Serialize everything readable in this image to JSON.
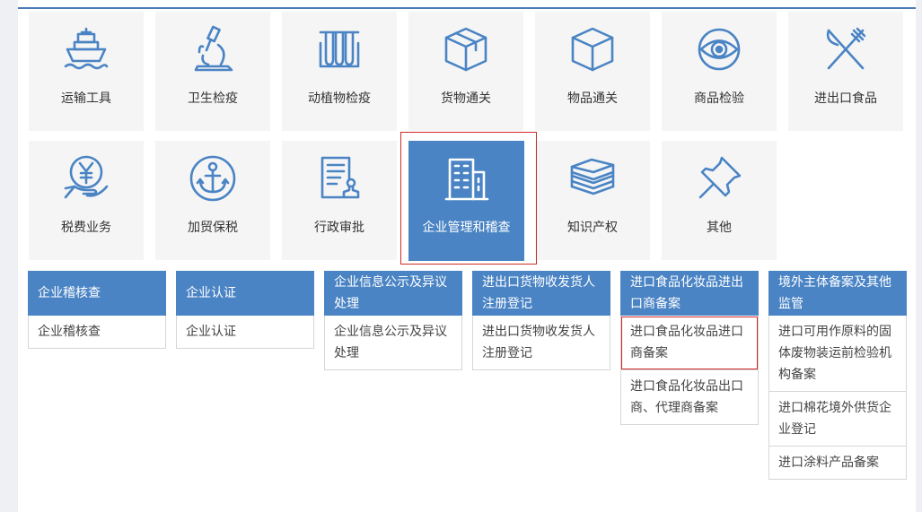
{
  "tiles_row1": [
    {
      "label": "运输工具",
      "icon": "ship-icon"
    },
    {
      "label": "卫生检疫",
      "icon": "microscope-icon"
    },
    {
      "label": "动植物检疫",
      "icon": "test-tubes-icon"
    },
    {
      "label": "货物通关",
      "icon": "package-box-icon"
    },
    {
      "label": "物品通关",
      "icon": "cube-icon"
    },
    {
      "label": "商品检验",
      "icon": "eye-icon"
    },
    {
      "label": "进出口食品",
      "icon": "fork-knife-icon"
    }
  ],
  "tiles_row2": [
    {
      "label": "税费业务",
      "icon": "yen-hand-icon"
    },
    {
      "label": "加贸保税",
      "icon": "anchor-icon"
    },
    {
      "label": "行政审批",
      "icon": "document-stamp-icon"
    },
    {
      "label": "企业管理和稽查",
      "icon": "building-icon",
      "active": true
    },
    {
      "label": "知识产权",
      "icon": "books-icon"
    },
    {
      "label": "其他",
      "icon": "pushpin-icon"
    }
  ],
  "columns": [
    {
      "header": "企业稽核查",
      "items": [
        "企业稽核查"
      ]
    },
    {
      "header": "企业认证",
      "items": [
        "企业认证"
      ]
    },
    {
      "header": "企业信息公示及异议处理",
      "items": [
        "企业信息公示及异议处理"
      ]
    },
    {
      "header": "进出口货物收发货人注册登记",
      "items": [
        "进出口货物收发货人注册登记"
      ]
    },
    {
      "header": "进口食品化妆品进出口商备案",
      "items": [
        "进口食品化妆品进口商备案",
        "进口食品化妆品出口商、代理商备案"
      ]
    },
    {
      "header": "境外主体备案及其他监管",
      "items": [
        "进口可用作原料的固体废物装运前检验机构备案",
        "进口棉花境外供货企业登记",
        "进口涂料产品备案"
      ]
    }
  ],
  "colors": {
    "accent": "#4a84c4",
    "icon": "#4a84c4",
    "highlight": "#d0292a"
  }
}
